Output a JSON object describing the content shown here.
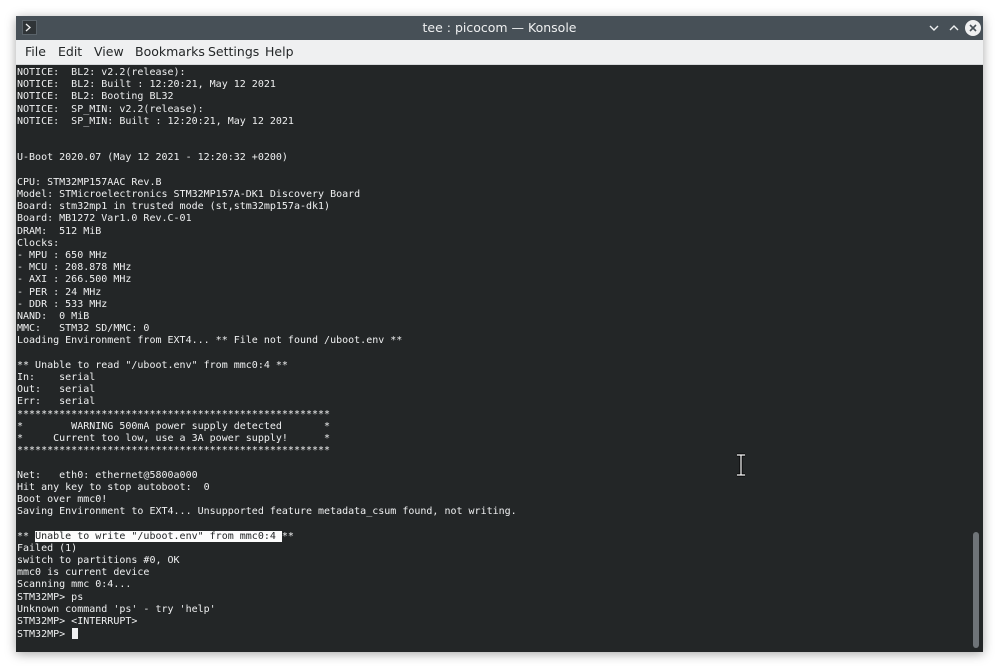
{
  "window": {
    "title": "tee : picocom — Konsole"
  },
  "menubar": {
    "items": [
      "File",
      "Edit",
      "View",
      "Bookmarks",
      "Settings",
      "Help"
    ]
  },
  "terminal": {
    "lines": [
      "NOTICE:  BL2: v2.2(release):",
      "NOTICE:  BL2: Built : 12:20:21, May 12 2021",
      "NOTICE:  BL2: Booting BL32",
      "NOTICE:  SP_MIN: v2.2(release):",
      "NOTICE:  SP_MIN: Built : 12:20:21, May 12 2021",
      "",
      "",
      "U-Boot 2020.07 (May 12 2021 - 12:20:32 +0200)",
      "",
      "CPU: STM32MP157AAC Rev.B",
      "Model: STMicroelectronics STM32MP157A-DK1 Discovery Board",
      "Board: stm32mp1 in trusted mode (st,stm32mp157a-dk1)",
      "Board: MB1272 Var1.0 Rev.C-01",
      "DRAM:  512 MiB",
      "Clocks:",
      "- MPU : 650 MHz",
      "- MCU : 208.878 MHz",
      "- AXI : 266.500 MHz",
      "- PER : 24 MHz",
      "- DDR : 533 MHz",
      "NAND:  0 MiB",
      "MMC:   STM32 SD/MMC: 0",
      "Loading Environment from EXT4... ** File not found /uboot.env **",
      "",
      "** Unable to read \"/uboot.env\" from mmc0:4 **",
      "In:    serial",
      "Out:   serial",
      "Err:   serial",
      "****************************************************",
      "*        WARNING 500mA power supply detected       *",
      "*     Current too low, use a 3A power supply!      *",
      "****************************************************",
      "",
      "Net:   eth0: ethernet@5800a000",
      "Hit any key to stop autoboot:  0",
      "Boot over mmc0!",
      "Saving Environment to EXT4... Unsupported feature metadata_csum found, not writing.",
      "",
      "",
      "Failed (1)",
      "switch to partitions #0, OK",
      "mmc0 is current device",
      "Scanning mmc 0:4...",
      "STM32MP> ps",
      "Unknown command 'ps' - try 'help'",
      "STM32MP> <INTERRUPT>",
      "STM32MP> "
    ],
    "selected_line": {
      "prefix": "** ",
      "selected": "Unable to write \"/uboot.env\" from mmc0:4 ",
      "suffix": "**"
    }
  },
  "icons": {
    "app": "terminal-icon",
    "minimize": "chevron-down-icon",
    "maximize": "chevron-up-icon",
    "close": "close-icon",
    "pointer": "text-cursor-icon"
  },
  "colors": {
    "terminal_bg": "#232627",
    "terminal_fg": "#eff0f1",
    "titlebar": "#475057",
    "menubar": "#eff0f1",
    "selection": "#fcfcfc"
  }
}
